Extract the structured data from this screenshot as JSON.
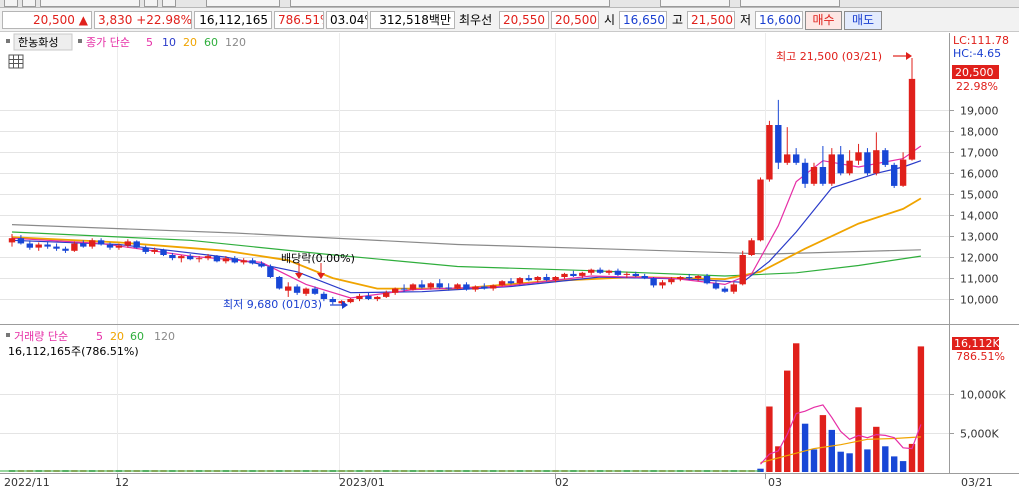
{
  "quote": {
    "price": "20,500",
    "up_arrow": "▲",
    "change": "3,830",
    "change_pct": "+22.98%",
    "volume": "16,112,165",
    "volume_ratio": "786.51%",
    "turnover_pct": "03.04%",
    "amount": "312,518백만",
    "best_ask_label": "최우선",
    "best_ask": "20,550",
    "best_bid": "20,500",
    "open_label": "시",
    "open": "16,650",
    "high_label": "고",
    "high": "21,500",
    "low_label": "저",
    "low": "16,600",
    "buy_label": "매수",
    "sell_label": "매도"
  },
  "legend": {
    "stock_name": "한농화성",
    "price_label": "종가 단순",
    "ma_periods": [
      "5",
      "10",
      "20",
      "60",
      "120"
    ],
    "volume_label": "거래량 단순",
    "volume_summary": "16,112,165주(786.51%)"
  },
  "annotations": {
    "high_marker": "최고 21,500 (03/21)",
    "low_marker": "최저 9,680 (01/03)",
    "dividend_marker": "배당락(0.00%)"
  },
  "right_axis": {
    "lc_label": "LC:111.78",
    "hc_label": "HC:-4.65",
    "current_price_tag": "20,500",
    "current_pct_tag": "22.98%",
    "volume_tag": "16,112K",
    "volume_pct_tag": "786.51%"
  },
  "x_axis_labels": [
    "2022/11",
    "12",
    "2023/01",
    "02",
    "03",
    "03/21"
  ],
  "colors": {
    "up": "#e0201b",
    "down": "#1847d6",
    "ma5": "#e62ea6",
    "ma10": "#2a3bc9",
    "ma20": "#f0a400",
    "ma60": "#2fae3c",
    "ma120": "#8a8a8a"
  },
  "chart_data": [
    {
      "type": "candlestick",
      "title": "",
      "ylim": [
        9000,
        22500
      ],
      "yticks": [
        10000,
        11000,
        12000,
        13000,
        14000,
        15000,
        16000,
        17000,
        18000,
        19000
      ],
      "ytick_labels": [
        "10,000",
        "11,000",
        "12,000",
        "13,000",
        "14,000",
        "15,000",
        "16,000",
        "17,000",
        "18,000",
        "19,000"
      ],
      "candles": [
        [
          12700,
          13100,
          12500,
          12900
        ],
        [
          12900,
          13050,
          12600,
          12650
        ],
        [
          12650,
          12800,
          12350,
          12450
        ],
        [
          12450,
          12700,
          12300,
          12600
        ],
        [
          12600,
          12750,
          12400,
          12500
        ],
        [
          12500,
          12650,
          12300,
          12400
        ],
        [
          12400,
          12500,
          12200,
          12300
        ],
        [
          12300,
          12750,
          12250,
          12650
        ],
        [
          12650,
          12800,
          12450,
          12500
        ],
        [
          12500,
          12900,
          12400,
          12800
        ],
        [
          12800,
          12900,
          12550,
          12600
        ],
        [
          12600,
          12700,
          12350,
          12450
        ],
        [
          12450,
          12650,
          12350,
          12550
        ],
        [
          12550,
          12850,
          12450,
          12750
        ],
        [
          12750,
          12800,
          12400,
          12450
        ],
        [
          12450,
          12550,
          12150,
          12250
        ],
        [
          12250,
          12450,
          12150,
          12350
        ],
        [
          12350,
          12400,
          12050,
          12100
        ],
        [
          12100,
          12200,
          11850,
          11950
        ],
        [
          11950,
          12100,
          11750,
          12050
        ],
        [
          12050,
          12150,
          11850,
          11900
        ],
        [
          11900,
          12050,
          11750,
          11950
        ],
        [
          11950,
          12150,
          11850,
          12050
        ],
        [
          12050,
          12100,
          11750,
          11800
        ],
        [
          11800,
          12050,
          11700,
          11950
        ],
        [
          11950,
          12050,
          11700,
          11750
        ],
        [
          11750,
          11950,
          11650,
          11850
        ],
        [
          11850,
          11950,
          11650,
          11700
        ],
        [
          11700,
          11800,
          11500,
          11550
        ],
        [
          11550,
          11650,
          11000,
          11050
        ],
        [
          11050,
          11100,
          10450,
          10500
        ],
        [
          10400,
          10800,
          10100,
          10600
        ],
        [
          10600,
          10700,
          10200,
          10300
        ],
        [
          10250,
          10550,
          10150,
          10500
        ],
        [
          10500,
          10600,
          10200,
          10250
        ],
        [
          10250,
          10350,
          9900,
          10000
        ],
        [
          10000,
          10100,
          9750,
          9850
        ],
        [
          9800,
          9950,
          9680,
          9900
        ],
        [
          9850,
          10050,
          9800,
          10000
        ],
        [
          10000,
          10250,
          9900,
          10150
        ],
        [
          10150,
          10300,
          9950,
          10000
        ],
        [
          10000,
          10150,
          9900,
          10100
        ],
        [
          10100,
          10400,
          10050,
          10300
        ],
        [
          10300,
          10550,
          10200,
          10500
        ],
        [
          10500,
          10700,
          10350,
          10450
        ],
        [
          10450,
          10750,
          10400,
          10700
        ],
        [
          10700,
          10900,
          10500,
          10550
        ],
        [
          10550,
          10800,
          10450,
          10750
        ],
        [
          10750,
          10950,
          10500,
          10550
        ],
        [
          10550,
          10750,
          10400,
          10500
        ],
        [
          10500,
          10750,
          10450,
          10700
        ],
        [
          10700,
          10800,
          10400,
          10450
        ],
        [
          10450,
          10650,
          10350,
          10600
        ],
        [
          10600,
          10750,
          10450,
          10500
        ],
        [
          10500,
          10700,
          10400,
          10650
        ],
        [
          10650,
          10900,
          10600,
          10850
        ],
        [
          10850,
          11000,
          10700,
          10750
        ],
        [
          10750,
          11050,
          10700,
          11000
        ],
        [
          11000,
          11150,
          10850,
          10900
        ],
        [
          10900,
          11100,
          10800,
          11050
        ],
        [
          11050,
          11200,
          10850,
          10900
        ],
        [
          10900,
          11100,
          10800,
          11050
        ],
        [
          11050,
          11250,
          10950,
          11200
        ],
        [
          11200,
          11350,
          11050,
          11100
        ],
        [
          11100,
          11300,
          11000,
          11250
        ],
        [
          11250,
          11450,
          11150,
          11400
        ],
        [
          11400,
          11500,
          11200,
          11250
        ],
        [
          11250,
          11400,
          11150,
          11350
        ],
        [
          11350,
          11450,
          11100,
          11150
        ],
        [
          11150,
          11300,
          11000,
          11200
        ],
        [
          11200,
          11300,
          11050,
          11100
        ],
        [
          11100,
          11200,
          10950,
          11000
        ],
        [
          11000,
          11050,
          10550,
          10650
        ],
        [
          10650,
          10900,
          10500,
          10800
        ],
        [
          10800,
          11050,
          10700,
          10950
        ],
        [
          10950,
          11100,
          10850,
          11050
        ],
        [
          11050,
          11200,
          10900,
          11000
        ],
        [
          11000,
          11150,
          10850,
          11100
        ],
        [
          11100,
          11200,
          10700,
          10750
        ],
        [
          10750,
          10850,
          10450,
          10500
        ],
        [
          10500,
          10600,
          10300,
          10350
        ],
        [
          10350,
          10800,
          10250,
          10700
        ],
        [
          10700,
          12300,
          10650,
          12100
        ],
        [
          12100,
          12900,
          12050,
          12800
        ],
        [
          12800,
          15800,
          12750,
          15700
        ],
        [
          15700,
          18500,
          15600,
          18300
        ],
        [
          18300,
          19500,
          16200,
          16500
        ],
        [
          16500,
          18200,
          16400,
          16900
        ],
        [
          16900,
          17200,
          16400,
          16500
        ],
        [
          16500,
          16700,
          15300,
          15500
        ],
        [
          15500,
          16500,
          15400,
          16300
        ],
        [
          16300,
          17300,
          15400,
          15500
        ],
        [
          15500,
          17200,
          15400,
          16900
        ],
        [
          16900,
          17300,
          15900,
          16000
        ],
        [
          16000,
          17100,
          15900,
          16600
        ],
        [
          16600,
          17400,
          16400,
          17000
        ],
        [
          17000,
          17200,
          15900,
          16000
        ],
        [
          16000,
          17950,
          15900,
          17100
        ],
        [
          17100,
          17200,
          16300,
          16400
        ],
        [
          16400,
          16500,
          15300,
          15400
        ],
        [
          15400,
          17000,
          15350,
          16650
        ],
        [
          16650,
          21500,
          16600,
          20500
        ]
      ],
      "moving_averages": {
        "ma5": [
          [
            0,
            12900
          ],
          [
            10,
            12650
          ],
          [
            20,
            12050
          ],
          [
            28,
            11750
          ],
          [
            33,
            10700
          ],
          [
            38,
            10050
          ],
          [
            45,
            10450
          ],
          [
            55,
            10600
          ],
          [
            65,
            11100
          ],
          [
            74,
            11000
          ],
          [
            80,
            10700
          ],
          [
            83,
            11200
          ],
          [
            86,
            13500
          ],
          [
            88,
            15600
          ],
          [
            91,
            16600
          ],
          [
            95,
            16300
          ],
          [
            100,
            16700
          ],
          [
            102,
            17300
          ]
        ],
        "ma10": [
          [
            0,
            12800
          ],
          [
            12,
            12600
          ],
          [
            24,
            12000
          ],
          [
            32,
            11300
          ],
          [
            38,
            10300
          ],
          [
            46,
            10350
          ],
          [
            56,
            10600
          ],
          [
            66,
            11050
          ],
          [
            76,
            10950
          ],
          [
            82,
            10800
          ],
          [
            85,
            11800
          ],
          [
            88,
            13200
          ],
          [
            92,
            15300
          ],
          [
            97,
            16000
          ],
          [
            100,
            16300
          ],
          [
            102,
            16600
          ]
        ],
        "ma20": [
          [
            0,
            12950
          ],
          [
            12,
            12700
          ],
          [
            24,
            12300
          ],
          [
            31,
            11850
          ],
          [
            36,
            11000
          ],
          [
            41,
            10500
          ],
          [
            50,
            10500
          ],
          [
            60,
            10850
          ],
          [
            70,
            11050
          ],
          [
            80,
            10950
          ],
          [
            84,
            11300
          ],
          [
            89,
            12400
          ],
          [
            95,
            13600
          ],
          [
            100,
            14300
          ],
          [
            102,
            14800
          ]
        ],
        "ma60": [
          [
            0,
            13200
          ],
          [
            20,
            12800
          ],
          [
            35,
            12150
          ],
          [
            50,
            11550
          ],
          [
            65,
            11350
          ],
          [
            80,
            11100
          ],
          [
            88,
            11250
          ],
          [
            95,
            11600
          ],
          [
            102,
            12050
          ]
        ],
        "ma120": [
          [
            0,
            13550
          ],
          [
            25,
            13150
          ],
          [
            50,
            12600
          ],
          [
            70,
            12350
          ],
          [
            85,
            12150
          ],
          [
            102,
            12350
          ]
        ]
      }
    },
    {
      "type": "bar",
      "title": "",
      "ylim": [
        0,
        16800
      ],
      "yticks": [
        5000,
        10000
      ],
      "ytick_labels": [
        "5,000K",
        "10,000K"
      ],
      "volumes_k": [
        [
          84,
          420,
          "down"
        ],
        [
          85,
          8400,
          "up"
        ],
        [
          86,
          3300,
          "up"
        ],
        [
          87,
          13000,
          "up"
        ],
        [
          88,
          16500,
          "up"
        ],
        [
          89,
          6200,
          "down"
        ],
        [
          90,
          2900,
          "down"
        ],
        [
          91,
          7300,
          "up"
        ],
        [
          92,
          5400,
          "down"
        ],
        [
          93,
          2600,
          "down"
        ],
        [
          94,
          2400,
          "down"
        ],
        [
          95,
          8300,
          "up"
        ],
        [
          96,
          2900,
          "down"
        ],
        [
          97,
          5800,
          "up"
        ],
        [
          98,
          3300,
          "down"
        ],
        [
          99,
          2000,
          "down"
        ],
        [
          100,
          1400,
          "down"
        ],
        [
          101,
          3600,
          "up"
        ],
        [
          102,
          16112,
          "up"
        ]
      ],
      "volume_ma5_k": [
        [
          84,
          1000
        ],
        [
          85,
          2300
        ],
        [
          86,
          2700
        ],
        [
          87,
          4800
        ],
        [
          88,
          7500
        ],
        [
          89,
          7800
        ],
        [
          90,
          8300
        ],
        [
          91,
          8600
        ],
        [
          92,
          7000
        ],
        [
          93,
          5200
        ],
        [
          94,
          4200
        ],
        [
          95,
          4700
        ],
        [
          96,
          4400
        ],
        [
          97,
          4800
        ],
        [
          98,
          4700
        ],
        [
          99,
          4400
        ],
        [
          100,
          3100
        ],
        [
          101,
          3000
        ],
        [
          102,
          6100
        ]
      ],
      "volume_ma20_k": [
        [
          84,
          1200
        ],
        [
          87,
          2100
        ],
        [
          90,
          3000
        ],
        [
          93,
          3500
        ],
        [
          96,
          4200
        ],
        [
          99,
          4300
        ],
        [
          102,
          4500
        ]
      ]
    }
  ]
}
